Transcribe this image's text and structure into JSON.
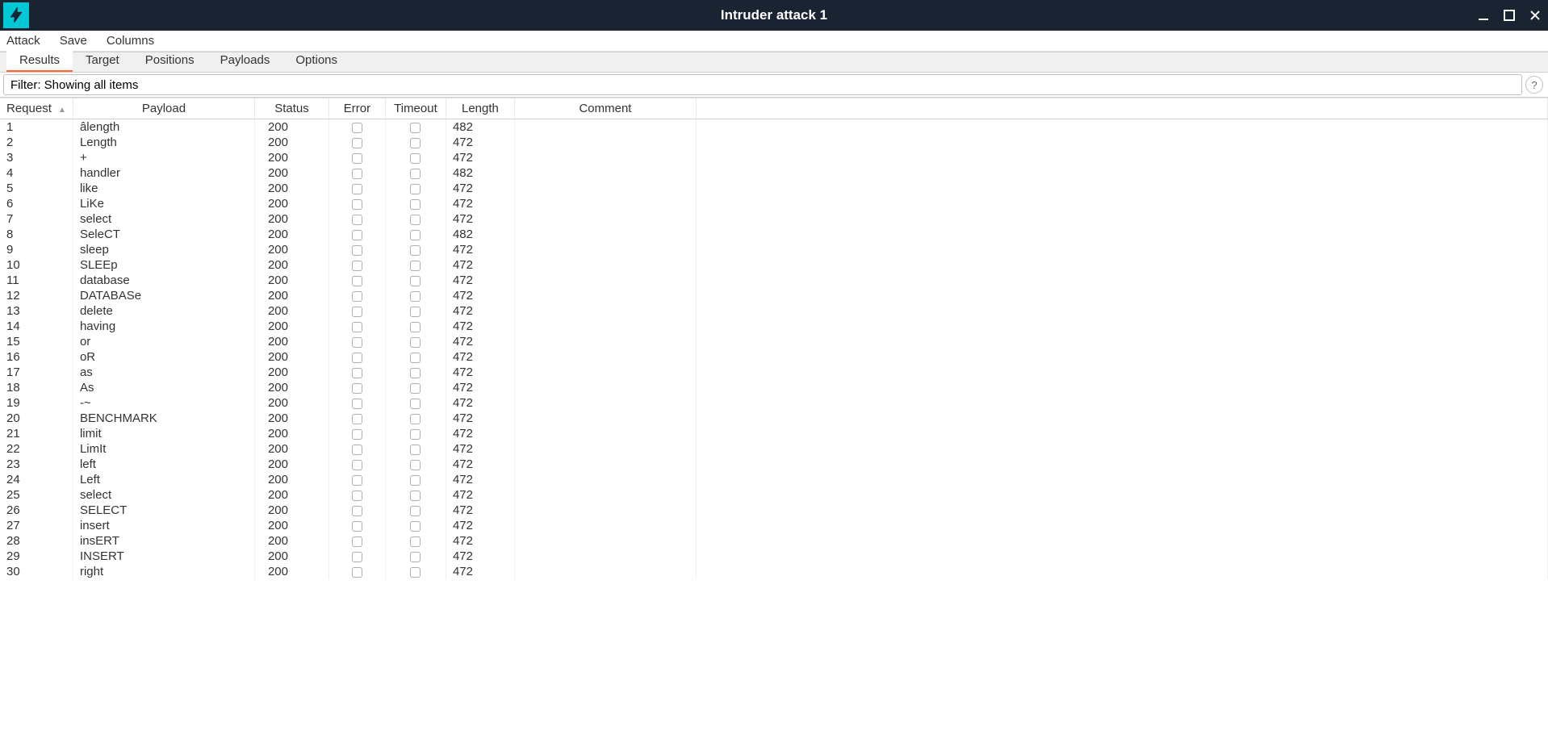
{
  "window": {
    "title": "Intruder attack 1"
  },
  "menu": {
    "attack": "Attack",
    "save": "Save",
    "columns": "Columns"
  },
  "tabs": {
    "results": "Results",
    "target": "Target",
    "positions": "Positions",
    "payloads": "Payloads",
    "options": "Options"
  },
  "filter": {
    "text": "Filter: Showing all items",
    "help": "?"
  },
  "table": {
    "headers": {
      "request": "Request",
      "payload": "Payload",
      "status": "Status",
      "error": "Error",
      "timeout": "Timeout",
      "length": "Length",
      "comment": "Comment"
    },
    "rows": [
      {
        "request": "1",
        "payload": "âlength",
        "status": "200",
        "error": false,
        "timeout": false,
        "length": "482",
        "comment": ""
      },
      {
        "request": "2",
        "payload": "Length",
        "status": "200",
        "error": false,
        "timeout": false,
        "length": "472",
        "comment": ""
      },
      {
        "request": "3",
        "payload": "+",
        "status": "200",
        "error": false,
        "timeout": false,
        "length": "472",
        "comment": ""
      },
      {
        "request": "4",
        "payload": "handler",
        "status": "200",
        "error": false,
        "timeout": false,
        "length": "482",
        "comment": ""
      },
      {
        "request": "5",
        "payload": "like",
        "status": "200",
        "error": false,
        "timeout": false,
        "length": "472",
        "comment": ""
      },
      {
        "request": "6",
        "payload": "LiKe",
        "status": "200",
        "error": false,
        "timeout": false,
        "length": "472",
        "comment": ""
      },
      {
        "request": "7",
        "payload": "select",
        "status": "200",
        "error": false,
        "timeout": false,
        "length": "472",
        "comment": ""
      },
      {
        "request": "8",
        "payload": "SeleCT",
        "status": "200",
        "error": false,
        "timeout": false,
        "length": "482",
        "comment": ""
      },
      {
        "request": "9",
        "payload": "sleep",
        "status": "200",
        "error": false,
        "timeout": false,
        "length": "472",
        "comment": ""
      },
      {
        "request": "10",
        "payload": "SLEEp",
        "status": "200",
        "error": false,
        "timeout": false,
        "length": "472",
        "comment": ""
      },
      {
        "request": "11",
        "payload": "database",
        "status": "200",
        "error": false,
        "timeout": false,
        "length": "472",
        "comment": ""
      },
      {
        "request": "12",
        "payload": "DATABASe",
        "status": "200",
        "error": false,
        "timeout": false,
        "length": "472",
        "comment": ""
      },
      {
        "request": "13",
        "payload": "delete",
        "status": "200",
        "error": false,
        "timeout": false,
        "length": "472",
        "comment": ""
      },
      {
        "request": "14",
        "payload": "having",
        "status": "200",
        "error": false,
        "timeout": false,
        "length": "472",
        "comment": ""
      },
      {
        "request": "15",
        "payload": "or",
        "status": "200",
        "error": false,
        "timeout": false,
        "length": "472",
        "comment": ""
      },
      {
        "request": "16",
        "payload": "oR",
        "status": "200",
        "error": false,
        "timeout": false,
        "length": "472",
        "comment": ""
      },
      {
        "request": "17",
        "payload": "as",
        "status": "200",
        "error": false,
        "timeout": false,
        "length": "472",
        "comment": ""
      },
      {
        "request": "18",
        "payload": "As",
        "status": "200",
        "error": false,
        "timeout": false,
        "length": "472",
        "comment": ""
      },
      {
        "request": "19",
        "payload": "-~",
        "status": "200",
        "error": false,
        "timeout": false,
        "length": "472",
        "comment": ""
      },
      {
        "request": "20",
        "payload": "BENCHMARK",
        "status": "200",
        "error": false,
        "timeout": false,
        "length": "472",
        "comment": ""
      },
      {
        "request": "21",
        "payload": "limit",
        "status": "200",
        "error": false,
        "timeout": false,
        "length": "472",
        "comment": ""
      },
      {
        "request": "22",
        "payload": "LimIt",
        "status": "200",
        "error": false,
        "timeout": false,
        "length": "472",
        "comment": ""
      },
      {
        "request": "23",
        "payload": "left",
        "status": "200",
        "error": false,
        "timeout": false,
        "length": "472",
        "comment": ""
      },
      {
        "request": "24",
        "payload": "Left",
        "status": "200",
        "error": false,
        "timeout": false,
        "length": "472",
        "comment": ""
      },
      {
        "request": "25",
        "payload": "select",
        "status": "200",
        "error": false,
        "timeout": false,
        "length": "472",
        "comment": ""
      },
      {
        "request": "26",
        "payload": "SELECT",
        "status": "200",
        "error": false,
        "timeout": false,
        "length": "472",
        "comment": ""
      },
      {
        "request": "27",
        "payload": "insert",
        "status": "200",
        "error": false,
        "timeout": false,
        "length": "472",
        "comment": ""
      },
      {
        "request": "28",
        "payload": "insERT",
        "status": "200",
        "error": false,
        "timeout": false,
        "length": "472",
        "comment": ""
      },
      {
        "request": "29",
        "payload": "INSERT",
        "status": "200",
        "error": false,
        "timeout": false,
        "length": "472",
        "comment": ""
      },
      {
        "request": "30",
        "payload": "right",
        "status": "200",
        "error": false,
        "timeout": false,
        "length": "472",
        "comment": ""
      }
    ]
  }
}
